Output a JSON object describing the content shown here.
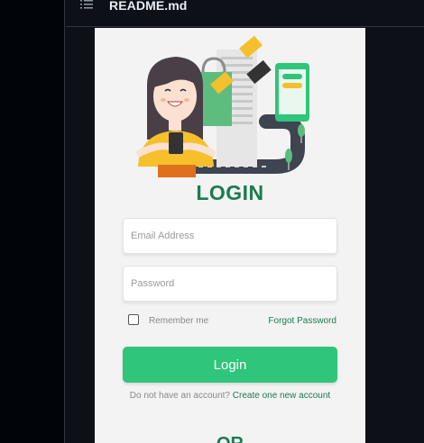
{
  "file": {
    "name": "README.md"
  },
  "login": {
    "title": "LOGIN",
    "email_placeholder": "Email Address",
    "password_placeholder": "Password",
    "remember_label": "Remember me",
    "forgot_label": "Forgot Password",
    "button_label": "Login",
    "signup_prompt": "Do not have an account?",
    "signup_link": "Create one new account",
    "or_label": "OR"
  },
  "colors": {
    "brand_green": "#1b7a52",
    "button_green": "#2fc57a",
    "accent_yellow": "#f5c02c"
  }
}
